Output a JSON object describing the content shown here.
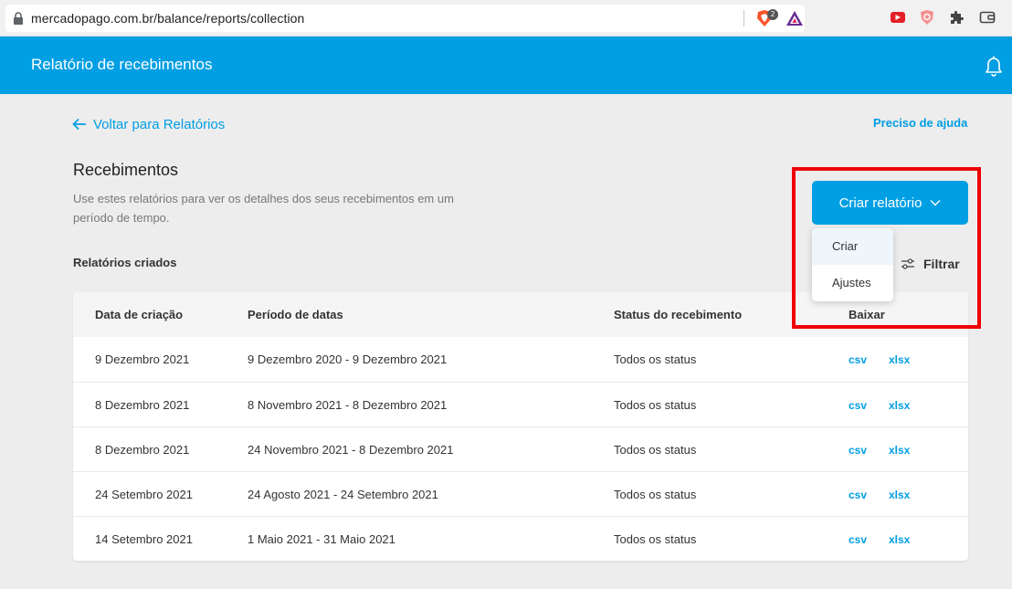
{
  "browser": {
    "url": "mercadopago.com.br/balance/reports/collection",
    "brave_badge": "2"
  },
  "header": {
    "title": "Relatório de recebimentos"
  },
  "nav": {
    "back_label": "Voltar para Relatórios",
    "help_label": "Preciso de ajuda"
  },
  "page": {
    "title": "Recebimentos",
    "description": "Use estes relatórios para ver os detalhes dos seus recebimentos em um período de tempo.",
    "section_label": "Relatórios criados"
  },
  "actions": {
    "create_label": "Criar relatório",
    "filter_label": "Filtrar",
    "menu": [
      "Criar",
      "Ajustes"
    ]
  },
  "table": {
    "headers": [
      "Data de criação",
      "Período de datas",
      "Status do recebimento",
      "Baixar"
    ],
    "rows": [
      {
        "created": "9 Dezembro 2021",
        "period": "9 Dezembro 2020 - 9 Dezembro 2021",
        "status": "Todos os status",
        "csv": "csv",
        "xlsx": "xlsx"
      },
      {
        "created": "8 Dezembro 2021",
        "period": "8 Novembro 2021 - 8 Dezembro 2021",
        "status": "Todos os status",
        "csv": "csv",
        "xlsx": "xlsx"
      },
      {
        "created": "8 Dezembro 2021",
        "period": "24 Novembro 2021 - 8 Dezembro 2021",
        "status": "Todos os status",
        "csv": "csv",
        "xlsx": "xlsx"
      },
      {
        "created": "24 Setembro 2021",
        "period": "24 Agosto 2021 - 24 Setembro 2021",
        "status": "Todos os status",
        "csv": "csv",
        "xlsx": "xlsx"
      },
      {
        "created": "14 Setembro 2021",
        "period": "1 Maio 2021 - 31 Maio 2021",
        "status": "Todos os status",
        "csv": "csv",
        "xlsx": "xlsx"
      }
    ]
  },
  "colors": {
    "brand": "#009ee3",
    "highlight": "#ee0000"
  },
  "icons": [
    "lock-icon",
    "brave-shield-icon",
    "brave-rewards-icon",
    "youtube-ext-icon",
    "shield-ext-icon",
    "puzzle-extensions-icon",
    "wallet-icon",
    "bell-icon",
    "arrow-left-icon",
    "chevron-down-icon",
    "sliders-icon"
  ]
}
